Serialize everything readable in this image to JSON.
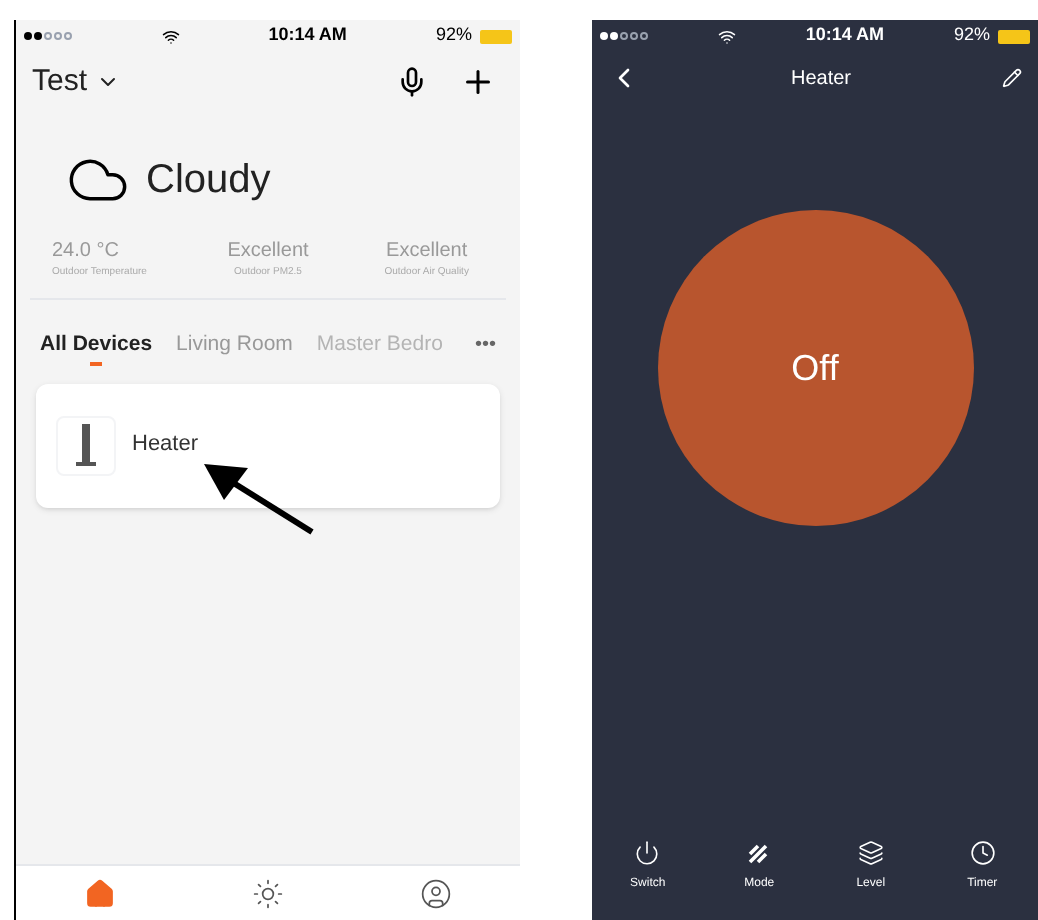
{
  "home_screen": {
    "status_bar": {
      "time": "10:14 AM",
      "battery": "92%"
    },
    "header": {
      "title": "Test"
    },
    "weather": {
      "condition": "Cloudy",
      "stats": [
        {
          "value": "24.0 °C",
          "label": "Outdoor Temperature"
        },
        {
          "value": "Excellent",
          "label": "Outdoor PM2.5"
        },
        {
          "value": "Excellent",
          "label": "Outdoor Air Quality"
        }
      ]
    },
    "tabs": [
      {
        "label": "All Devices",
        "selected": true
      },
      {
        "label": "Living Room",
        "selected": false
      },
      {
        "label": "Master Bedro",
        "selected": false
      }
    ],
    "more": "•••",
    "devices": [
      {
        "name": "Heater"
      }
    ],
    "bottom_nav": [
      {
        "kind": "home",
        "selected": true
      },
      {
        "kind": "scene",
        "selected": false
      },
      {
        "kind": "me",
        "selected": false
      }
    ]
  },
  "device_screen": {
    "status_bar": {
      "time": "10:14 AM",
      "battery": "92%"
    },
    "title": "Heater",
    "power_state": "Off",
    "controls": [
      {
        "kind": "power",
        "label": "Switch"
      },
      {
        "kind": "mode",
        "label": "Mode"
      },
      {
        "kind": "level",
        "label": "Level"
      },
      {
        "kind": "timer",
        "label": "Timer"
      }
    ]
  }
}
